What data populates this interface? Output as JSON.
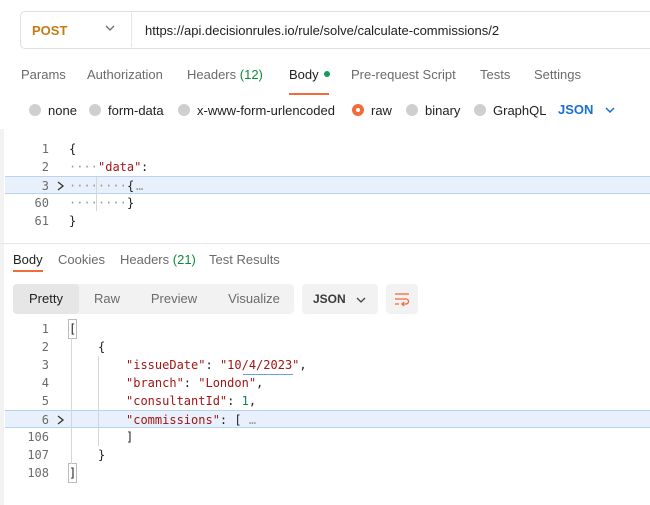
{
  "request": {
    "method": "POST",
    "url": "https://api.decisionrules.io/rule/solve/calculate-commissions/2"
  },
  "request_tabs": {
    "params": "Params",
    "authorization": "Authorization",
    "headers": "Headers",
    "headers_count": "(12)",
    "body": "Body",
    "prerequest": "Pre-request Script",
    "tests": "Tests",
    "settings": "Settings"
  },
  "body_types": {
    "none": "none",
    "form_data": "form-data",
    "urlencoded": "x-www-form-urlencoded",
    "raw": "raw",
    "binary": "binary",
    "graphql": "GraphQL",
    "selected_format": "JSON"
  },
  "request_editor": {
    "line_numbers": [
      "1",
      "2",
      "3",
      "60",
      "61"
    ],
    "open_brace": "{",
    "data_key": "\"data\"",
    "colon": ":",
    "inner_open": "{",
    "ellipsis": "…",
    "inner_close": "}",
    "close_brace": "}"
  },
  "response_tabs": {
    "body": "Body",
    "cookies": "Cookies",
    "headers": "Headers",
    "headers_count": "(21)",
    "test_results": "Test Results"
  },
  "view_modes": {
    "pretty": "Pretty",
    "raw": "Raw",
    "preview": "Preview",
    "visualize": "Visualize",
    "format": "JSON"
  },
  "response_editor": {
    "line_numbers": [
      "1",
      "2",
      "3",
      "4",
      "5",
      "6",
      "106",
      "107",
      "108"
    ],
    "open_bracket": "[",
    "open_brace": "{",
    "issue_key": "\"issueDate\"",
    "issue_val": "\"10/4/2023\"",
    "branch_key": "\"branch\"",
    "branch_val": "\"London\"",
    "consultant_key": "\"consultantId\"",
    "consultant_val": "1",
    "commissions_key": "\"commissions\"",
    "commissions_open": "[",
    "ellipsis": "…",
    "commissions_close": "]",
    "close_brace": "}",
    "close_bracket": "]"
  }
}
